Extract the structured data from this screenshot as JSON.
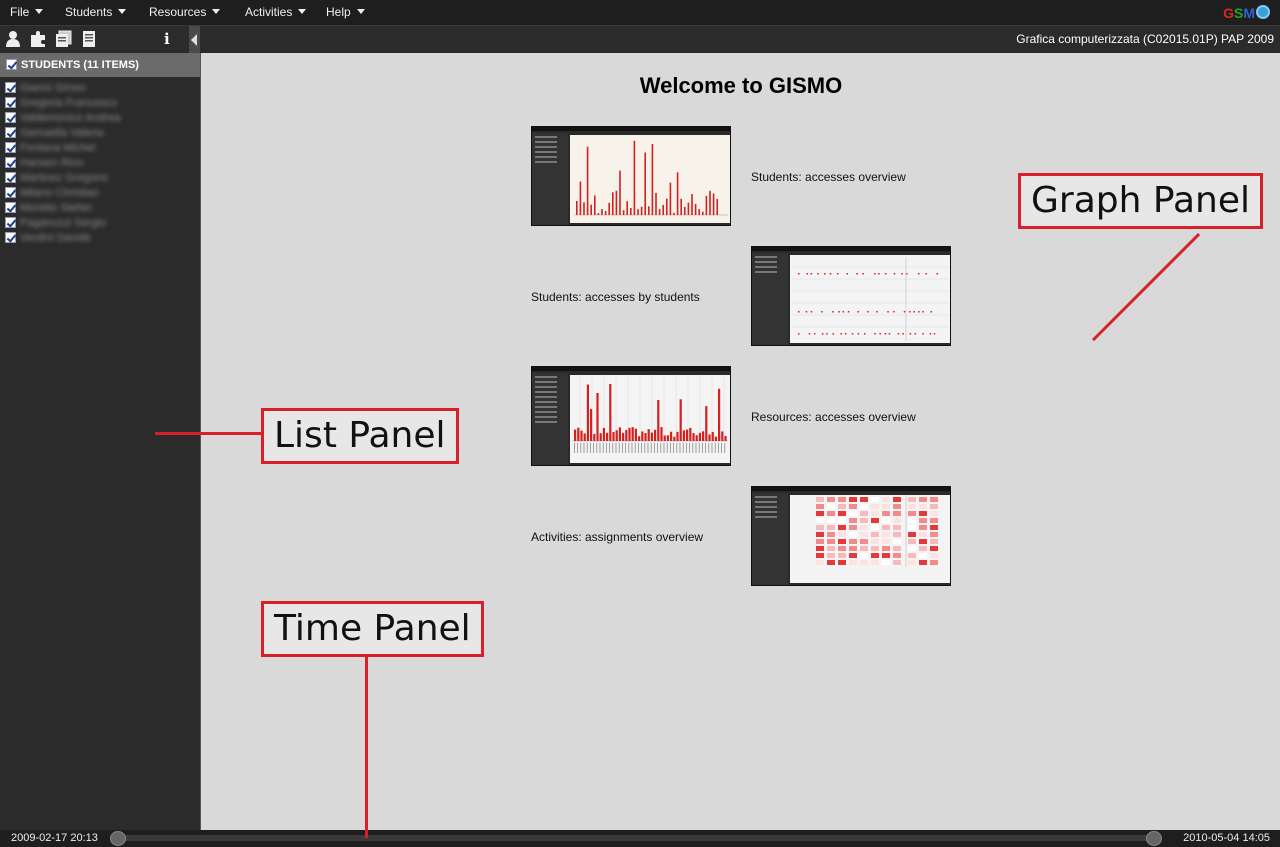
{
  "menu": {
    "items": [
      {
        "label": "File"
      },
      {
        "label": "Students"
      },
      {
        "label": "Resources"
      },
      {
        "label": "Activities"
      },
      {
        "label": "Help"
      }
    ]
  },
  "logo": {
    "g": "G",
    "s": "S",
    "m": "M"
  },
  "toolbar": {
    "icons": [
      "students-icon",
      "plugin-icon",
      "resources-icon",
      "activities-icon"
    ],
    "info_label": "i"
  },
  "course_title": "Grafica computerizzata (C02015.01P) PAP 2009",
  "list_panel": {
    "header": "STUDENTS (11 ITEMS)",
    "students": [
      "Gianni Simon",
      "Gregoria Francesco",
      "Valdemonico Andrea",
      "Gemaella Valeria",
      "Fontana Michel",
      "Hansen Rino",
      "Martinez Gregorio",
      "Milano Christian",
      "Moretto Stefan",
      "Paganuzzi Sergio",
      "Verdini Davide"
    ]
  },
  "main": {
    "welcome": "Welcome to GISMO",
    "views": [
      {
        "caption": "Students: accesses overview"
      },
      {
        "caption": "Students: accesses by students"
      },
      {
        "caption": "Resources: accesses overview"
      },
      {
        "caption": "Activities: assignments overview"
      }
    ]
  },
  "time_panel": {
    "start": "2009-02-17 20:13",
    "end": "2010-05-04 14:05"
  },
  "annotations": {
    "graph": "Graph Panel",
    "list": "List Panel",
    "time": "Time Panel"
  },
  "colors": {
    "accent_red": "#d8202a",
    "bar_red": "#d62020",
    "panel_dark": "#2b2b2b",
    "background": "#d9d9d9"
  }
}
